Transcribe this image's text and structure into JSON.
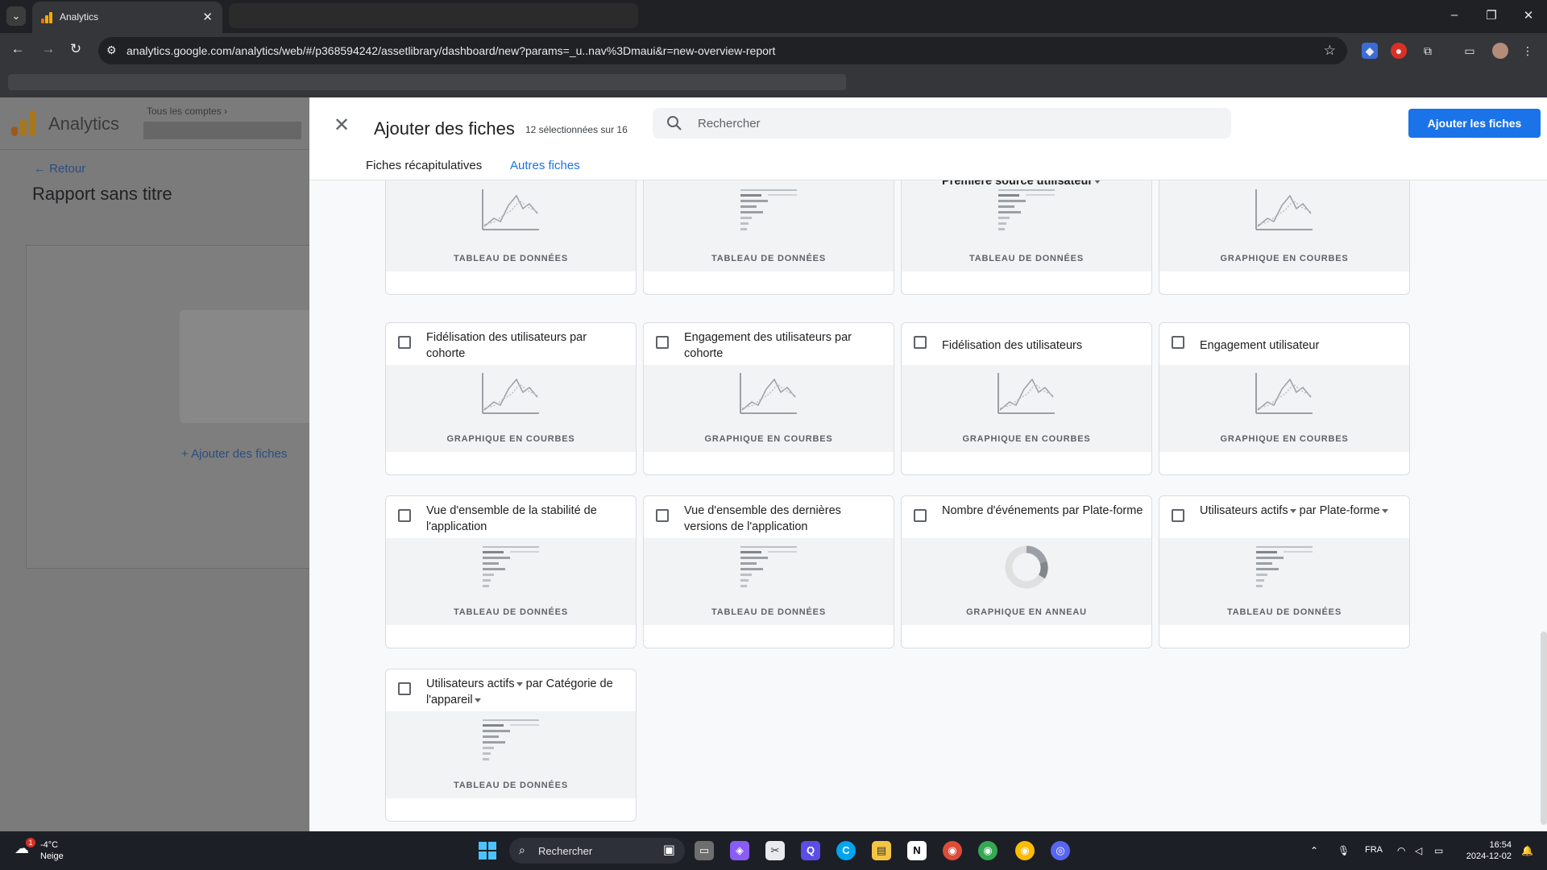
{
  "browser": {
    "tab_title": "Analytics",
    "url": "analytics.google.com/analytics/web/#/p368594242/assetlibrary/dashboard/new?params=_u..nav%3Dmaui&r=new-overview-report"
  },
  "ga": {
    "app_name": "Analytics",
    "accounts_label": "Tous les comptes",
    "back_label": "Retour",
    "report_title": "Rapport sans titre",
    "add_tiles_link": "Ajouter des fiches"
  },
  "drawer": {
    "title": "Ajouter des fiches",
    "selected_count": "12 sélectionnées sur 16",
    "search_placeholder": "Rechercher",
    "add_button": "Ajouter les fiches",
    "tabs": [
      "Fiches récapitulatives",
      "Autres fiches"
    ],
    "active_tab": "Autres fiches",
    "partial_cards": [
      {
        "title": "",
        "type": "TABLEAU DE DONNÉES",
        "icon": "line-chart-icon"
      },
      {
        "title": "",
        "type": "TABLEAU DE DONNÉES",
        "icon": "table-icon"
      },
      {
        "title": "Première source utilisateur",
        "type": "TABLEAU DE DONNÉES",
        "icon": "table-icon"
      },
      {
        "title": "",
        "type": "GRAPHIQUE EN COURBES",
        "icon": "line-chart-icon"
      }
    ],
    "cards": [
      {
        "title": "Fidélisation des utilisateurs par cohorte",
        "type": "GRAPHIQUE EN COURBES",
        "icon": "line-chart-icon"
      },
      {
        "title": "Engagement des utilisateurs par cohorte",
        "type": "GRAPHIQUE EN COURBES",
        "icon": "line-chart-icon"
      },
      {
        "title": "Fidélisation des utilisateurs",
        "type": "GRAPHIQUE EN COURBES",
        "icon": "line-chart-icon"
      },
      {
        "title": "Engagement utilisateur",
        "type": "GRAPHIQUE EN COURBES",
        "icon": "line-chart-icon"
      },
      {
        "title": "Vue d'ensemble de la stabilité de l'application",
        "type": "TABLEAU DE DONNÉES",
        "icon": "table-icon"
      },
      {
        "title": "Vue d'ensemble des dernières versions de l'application",
        "type": "TABLEAU DE DONNÉES",
        "icon": "table-icon"
      },
      {
        "title": "Nombre d'événements par Plate-forme",
        "type": "GRAPHIQUE EN ANNEAU",
        "icon": "donut-chart-icon"
      },
      {
        "title_parts": [
          "Utilisateurs actifs",
          "par",
          "Plate-forme"
        ],
        "type": "TABLEAU DE DONNÉES",
        "icon": "table-icon"
      },
      {
        "title_parts": [
          "Utilisateurs actifs",
          "par",
          "Catégorie de l'appareil"
        ],
        "type": "TABLEAU DE DONNÉES",
        "icon": "table-icon"
      }
    ]
  },
  "taskbar": {
    "weather_temp": "-4°C",
    "weather_desc": "Neige",
    "weather_badge": "1",
    "search_label": "Rechercher",
    "language": "FRA",
    "time": "16:54",
    "date": "2024-12-02"
  },
  "colors": {
    "accent": "#1a73e8",
    "ga_orange": "#f9ab00",
    "ga_dark_orange": "#e37400"
  }
}
